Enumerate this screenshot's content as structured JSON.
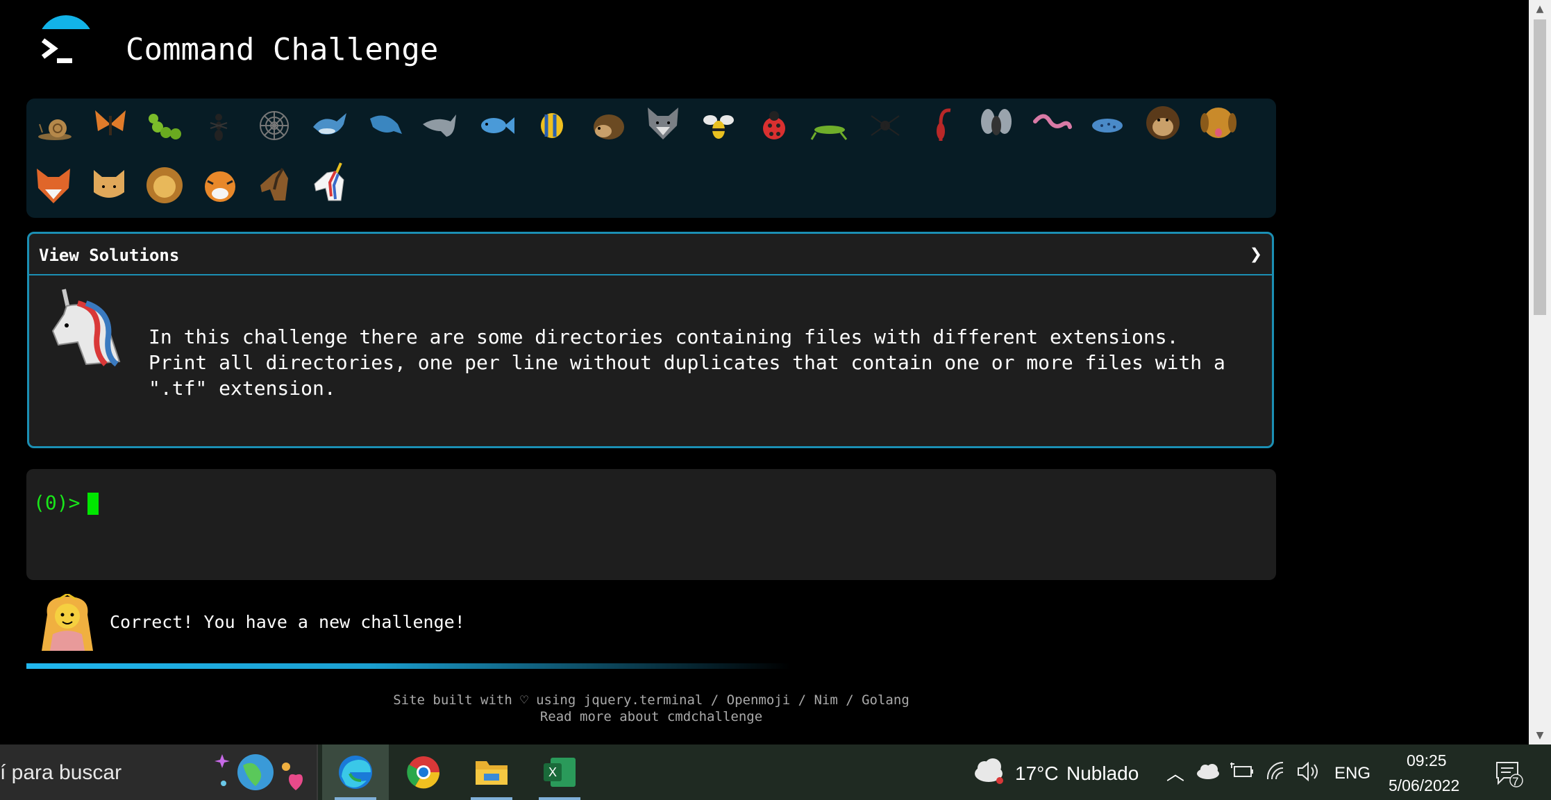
{
  "header": {
    "title": "Command Challenge"
  },
  "animals": {
    "row1": [
      "snail-icon",
      "butterfly-icon",
      "caterpillar-icon",
      "ant-icon",
      "spider-web-icon",
      "whale-icon",
      "whale-2-icon",
      "dolphin-icon",
      "fish-icon",
      "tropical-fish-icon",
      "hedgehog-icon",
      "wolf-icon",
      "bee-icon",
      "ladybug-icon",
      "cricket-icon",
      "spider-icon",
      "scorpion-icon",
      "fly-icon",
      "worm-icon",
      "microbe-icon",
      "monkey-face-icon",
      "dog-face-icon"
    ],
    "row2": [
      "fox-face-icon",
      "cat-face-icon",
      "lion-face-icon",
      "tiger-face-icon",
      "horse-icon",
      "unicorn-icon"
    ]
  },
  "solutions": {
    "title": "View Solutions",
    "chevron": "❯",
    "text": "In this challenge there are some directories containing files with different extensions.\nPrint all directories, one per line without duplicates that contain one or more files with a\n\".tf\" extension."
  },
  "terminal": {
    "prompt": "(0)>"
  },
  "feedback": {
    "message": "Correct! You have a new challenge!"
  },
  "footer": {
    "line1": "Site built with ♡ using jquery.terminal / Openmoji / Nim / Golang",
    "line2": "Read more about cmdchallenge"
  },
  "taskbar": {
    "search_text": "í para buscar",
    "apps": [
      "edge-icon",
      "chrome-icon",
      "file-explorer-icon",
      "excel-icon"
    ],
    "weather_temp": "17°C",
    "weather_desc": "Nublado",
    "language": "ENG",
    "time": "09:25",
    "date": "5/06/2022",
    "notification_count": "7"
  },
  "colors": {
    "accent": "#1b8fb4",
    "terminal_prompt": "#19e619",
    "panel_bg": "#071c25",
    "box_bg": "#1e1e1e"
  }
}
